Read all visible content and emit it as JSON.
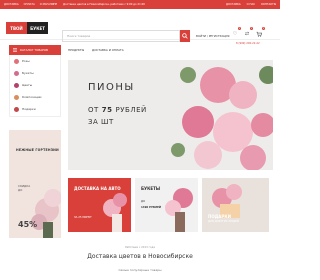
{
  "topbar": {
    "nav": [
      "ДОСТАВКА",
      "ОПЛАТА",
      "О МАГАЗИНЕ"
    ],
    "promo": "Доставка цветов в Новосибирске, работаем с 9:00 до 21:00",
    "right": [
      "ДОСТАВКА",
      "О НАС",
      "КОНТАКТЫ"
    ]
  },
  "logo": {
    "part1": "ТВОЙ",
    "part2": "БУКЕТ"
  },
  "search": {
    "placeholder": "Поиск товаров"
  },
  "account": {
    "login": "ВОЙТИ / РЕГИСТРАЦИЯ",
    "phone": "8 (999) 200-22-22"
  },
  "header_icons": [
    {
      "name": "heart-icon",
      "glyph": "♡",
      "badge": "0"
    },
    {
      "name": "compare-icon",
      "glyph": "⇄",
      "badge": "0"
    },
    {
      "name": "cart-icon",
      "glyph": "🛒",
      "badge": "0"
    }
  ],
  "catalog": {
    "label": "КАТАЛОГ ТОВАРОВ"
  },
  "menu": [
    "ПРОДУКТЫ",
    "ДОСТАВКА И ОПЛАТА"
  ],
  "sidebar": {
    "items": [
      {
        "label": "Розы",
        "color": "#e0707a"
      },
      {
        "label": "Букеты",
        "color": "#d36d8d"
      },
      {
        "label": "Цветы",
        "color": "#b3426a"
      },
      {
        "label": "Композиции",
        "color": "#d88f5c"
      },
      {
        "label": "Подарки",
        "color": "#c04a4a"
      }
    ]
  },
  "side_promo": {
    "title": "НЕЖНЫЕ ГОРТЕНЗИИ",
    "sub1": "СКИДКА",
    "sub2": "ДО",
    "percent": "45%"
  },
  "hero": {
    "title": "ПИОНЫ",
    "price_prefix": "ОТ",
    "price_value": "75",
    "price_suffix": "РУБЛЕЙ",
    "per": "ЗА ШТ"
  },
  "cards": [
    {
      "title": "ДОСТАВКА НА АВТО",
      "sub": "ЗА 25 МИНУТ"
    },
    {
      "title": "БУКЕТЫ",
      "sub_line1": "ДО",
      "sub_line2": "1490 РУБЛЕЙ"
    },
    {
      "title": "ПОДАРКИ",
      "sub": "ДЛЯ ДОРОГИХ ЛЮДЕЙ"
    }
  ],
  "footer": {
    "small": "Работаем с 2013 года",
    "heading": "Доставка цветов в Новосибирске",
    "sub": "Самые популярные товары"
  },
  "colors": {
    "accent": "#d9403a",
    "dark": "#222222",
    "hero_bg": "#eeeceb"
  }
}
